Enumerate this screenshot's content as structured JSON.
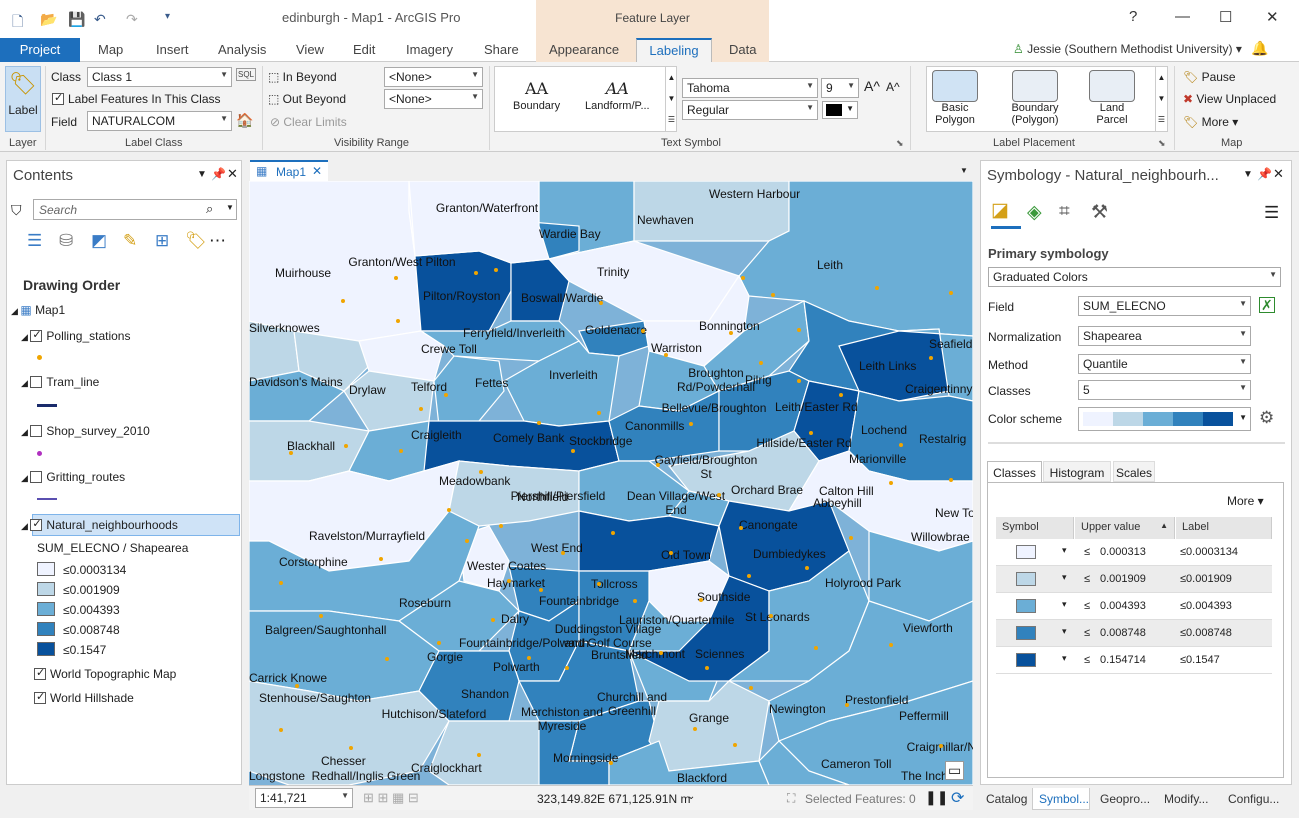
{
  "app": {
    "title": "edinburgh - Map1 - ArcGIS Pro",
    "context_tab": "Feature Layer",
    "help": "?",
    "user": "Jessie (Southern Methodist University)"
  },
  "ribbon_tabs": [
    "Project",
    "Map",
    "Insert",
    "Analysis",
    "View",
    "Edit",
    "Imagery",
    "Share",
    "Appearance",
    "Labeling",
    "Data"
  ],
  "ribbon": {
    "layer": {
      "label_button": "Label",
      "group": "Layer"
    },
    "label_class": {
      "class_label": "Class",
      "class_value": "Class 1",
      "label_features": "Label Features In This Class",
      "field_label": "Field",
      "field_value": "NATURALCOM",
      "group": "Label Class",
      "sql": "SQL"
    },
    "visibility": {
      "in_beyond": "In Beyond",
      "out_beyond": "Out Beyond",
      "clear_limits": "Clear Limits",
      "min_scale": "<None>",
      "max_scale": "<None>",
      "group": "Visibility Range"
    },
    "text_symbol": {
      "gallery": [
        {
          "glyph": "AA",
          "label": "Boundary"
        },
        {
          "glyph": "AA",
          "label": "Landform/P..."
        }
      ],
      "font": "Tahoma",
      "size": "9",
      "style": "Regular",
      "group": "Text Symbol",
      "grow_icon": "A^",
      "shrink_icon": "A^"
    },
    "label_placement": {
      "items": [
        "Basic Polygon",
        "Boundary (Polygon)",
        "Land Parcel"
      ],
      "group": "Label Placement"
    },
    "map": {
      "pause": "Pause",
      "view_unplaced": "View Unplaced",
      "more": "More",
      "group": "Map"
    }
  },
  "contents": {
    "title": "Contents",
    "search_placeholder": "Search",
    "drawing_order": "Drawing Order",
    "map_name": "Map1",
    "layers": [
      {
        "name": "Polling_stations",
        "checked": true
      },
      {
        "name": "Tram_line",
        "checked": false
      },
      {
        "name": "Shop_survey_2010",
        "checked": false
      },
      {
        "name": "Gritting_routes",
        "checked": false
      },
      {
        "name": "Natural_neighbourhoods",
        "checked": true
      }
    ],
    "legend_title": "SUM_ELECNO / Shapearea",
    "legend": [
      "≤0.0003134",
      "≤0.001909",
      "≤0.004393",
      "≤0.008748",
      "≤0.1547"
    ],
    "basemaps": [
      "World Topographic Map",
      "World Hillshade"
    ]
  },
  "map": {
    "tab": "Map1",
    "scale": "1:41,721",
    "coords": "323,149.82E 671,125.91N m",
    "selected": "Selected Features: 0",
    "neighbourhoods": [
      "Granton/Waterfront",
      "Western Harbour",
      "Newhaven",
      "Wardie Bay",
      "Leith",
      "Muirhouse",
      "Granton/West Pilton",
      "Trinity",
      "Pilton/Royston",
      "Boswall/Wardie",
      "Bonnington",
      "Silverknowes",
      "Ferryfield/Inverleith",
      "Goldenacre",
      "Crewe Toll",
      "Warriston",
      "Seafield",
      "Leith Links",
      "Davidson's Mains",
      "Telford",
      "Fettes",
      "Inverleith",
      "Broughton Rd/Powderhall",
      "Pilrig",
      "Craigentinny",
      "Drylaw",
      "Bellevue/Broughton",
      "Leith/Easter Rd",
      "Blackhall",
      "Craigleith",
      "Comely Bank",
      "Stockbridge",
      "Canonmills",
      "Hillside/Easter Rd",
      "Lochend",
      "Restalrig",
      "Gayfield/Broughton St",
      "Marionville",
      "Meadowbank",
      "Orchard Brae",
      "Calton Hill",
      "Abbeyhill",
      "Piershill/Piersfield",
      "Dean Village/West End",
      "New Town",
      "Northfield",
      "Willowbrae",
      "Ravelston/Murrayfield",
      "Canongate",
      "West End",
      "Dumbiedykes",
      "Corstorphine",
      "Wester Coates",
      "Old Town",
      "Holyrood Park",
      "Haymarket",
      "Tollcross",
      "Roseburn",
      "Fountainbridge",
      "Southside",
      "Dalry",
      "Lauriston/Quartermile",
      "St Leonards",
      "Balgreen/Saughtonhall",
      "Viewforth",
      "Duddingston Village and Golf Course",
      "Fountainbridge/Polwarth",
      "Gorgie",
      "Bruntsfield",
      "Marchmont",
      "Sciennes",
      "Polwarth",
      "Carrick Knowe",
      "Shandon",
      "Churchill and Greenhill",
      "Stenhouse/Saughton",
      "Newington",
      "Prestonfield",
      "Merchiston and Myreside",
      "Hutchison/Slateford",
      "Grange",
      "Peffermill",
      "Craigmillar/Niddrie",
      "Morningside",
      "Chesser",
      "Cameron Toll",
      "Longstone",
      "Redhall/Inglis Green",
      "Craiglockhart",
      "The Inch",
      "Blackford"
    ]
  },
  "symbology": {
    "title": "Symbology - Natural_neighbourh...",
    "primary": "Primary symbology",
    "method_type": "Graduated Colors",
    "field_label": "Field",
    "field_value": "SUM_ELECNO",
    "normalization_label": "Normalization",
    "normalization_value": "Shapearea",
    "method_label": "Method",
    "method_value": "Quantile",
    "classes_label": "Classes",
    "classes_value": "5",
    "scheme_label": "Color scheme",
    "tabs": [
      "Classes",
      "Histogram",
      "Scales"
    ],
    "more": "More",
    "headers": [
      "Symbol",
      "Upper value",
      "Label"
    ],
    "rows": [
      {
        "le": "≤",
        "upper": "0.000313",
        "label": "≤0.0003134"
      },
      {
        "le": "≤",
        "upper": "0.001909",
        "label": "≤0.001909"
      },
      {
        "le": "≤",
        "upper": "0.004393",
        "label": "≤0.004393"
      },
      {
        "le": "≤",
        "upper": "0.008748",
        "label": "≤0.008748"
      },
      {
        "le": "≤",
        "upper": "0.154714",
        "label": "≤0.1547"
      }
    ],
    "colors": [
      "#eff3ff",
      "#bdd7e7",
      "#6baed6",
      "#3182bd",
      "#08519c"
    ]
  },
  "bottom_tabs": [
    "Catalog",
    "Symbol...",
    "Geopro...",
    "Modify...",
    "Configu..."
  ]
}
